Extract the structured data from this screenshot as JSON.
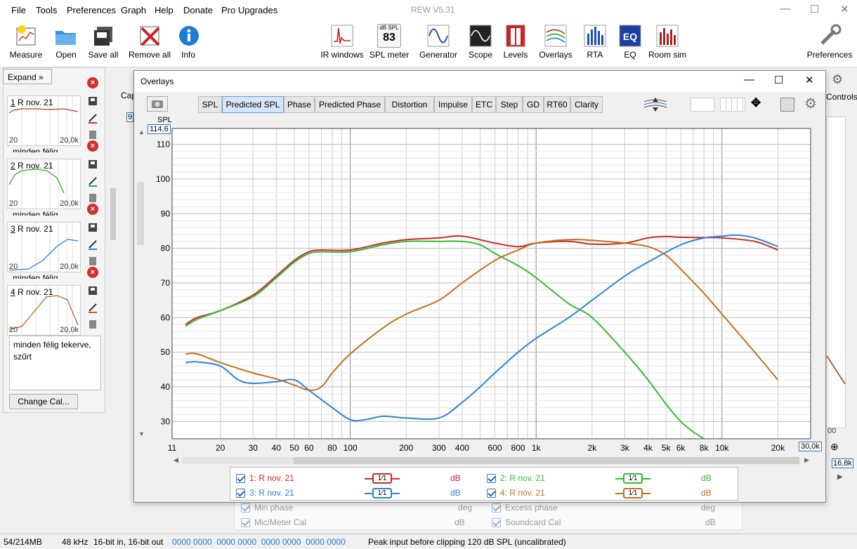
{
  "menu": [
    "File",
    "Tools",
    "Preferences",
    "Graph",
    "Help",
    "Donate",
    "Pro Upgrades"
  ],
  "app_title": "REW V5.31",
  "toolbar_left": [
    "Measure",
    "Open",
    "Save all",
    "Remove all",
    "Info"
  ],
  "toolbar_center": [
    "IR windows",
    "SPL meter",
    "Generator",
    "Scope",
    "Levels",
    "Overlays",
    "RTA",
    "EQ",
    "Room sim"
  ],
  "spl_meter": {
    "top": "dB SPL",
    "value": "83"
  },
  "toolbar_right": "Preferences",
  "left": {
    "expand": "Expand",
    "measurements": [
      {
        "num": "1",
        "name": "R nov. 21",
        "x_start": "20",
        "x_end": "20,0k",
        "color": "#c0392b",
        "subtitle": "minden félig"
      },
      {
        "num": "2",
        "name": "R nov. 21",
        "x_start": "20",
        "x_end": "20,0k",
        "color": "#2eaa2e",
        "subtitle": "minden félig"
      },
      {
        "num": "3",
        "name": "R nov. 21",
        "x_start": "20",
        "x_end": "20,0k",
        "color": "#2b7fd4",
        "subtitle": "minden félig"
      },
      {
        "num": "4",
        "name": "R nov. 21",
        "x_start": "20",
        "x_end": "20,0k",
        "color": "#b8661b",
        "subtitle": ""
      }
    ],
    "notes": "minden félig tekerve, szűrt",
    "change_cal": "Change Cal..."
  },
  "behind": {
    "cap": "Cap",
    "controls": "Controls",
    "nine": "9",
    "zero": "00",
    "k16": "16,8k"
  },
  "overlays": {
    "title": "Overlays",
    "tabs": [
      "SPL",
      "Predicted SPL",
      "Phase",
      "Predicted Phase",
      "Distortion",
      "Impulse",
      "ETC",
      "Step",
      "GD",
      "RT60",
      "Clarity"
    ],
    "active_tab": "Predicted SPL",
    "ylabel": "SPL",
    "ymax_box": "114,6",
    "xmax_box": "30,0k"
  },
  "chart_data": {
    "type": "line",
    "xscale": "log",
    "xlim": [
      11,
      30000
    ],
    "ylim": [
      25,
      114.6
    ],
    "yticks": [
      30,
      40,
      50,
      60,
      70,
      80,
      90,
      100,
      110
    ],
    "xticks": [
      {
        "v": 11,
        "l": "11"
      },
      {
        "v": 20,
        "l": "20"
      },
      {
        "v": 30,
        "l": "30"
      },
      {
        "v": 40,
        "l": "40"
      },
      {
        "v": 50,
        "l": "50"
      },
      {
        "v": 60,
        "l": "60"
      },
      {
        "v": 80,
        "l": "80"
      },
      {
        "v": 100,
        "l": "100"
      },
      {
        "v": 200,
        "l": "200"
      },
      {
        "v": 300,
        "l": "300"
      },
      {
        "v": 400,
        "l": "400"
      },
      {
        "v": 600,
        "l": "600"
      },
      {
        "v": 800,
        "l": "800"
      },
      {
        "v": 1000,
        "l": "1k"
      },
      {
        "v": 2000,
        "l": "2k"
      },
      {
        "v": 3000,
        "l": "3k"
      },
      {
        "v": 4000,
        "l": "4k"
      },
      {
        "v": 5000,
        "l": "5k"
      },
      {
        "v": 6000,
        "l": "6k"
      },
      {
        "v": 8000,
        "l": "8k"
      },
      {
        "v": 10000,
        "l": "10k"
      },
      {
        "v": 20000,
        "l": "20k"
      }
    ],
    "grid": true,
    "series": [
      {
        "name": "1: R nov. 21",
        "color": "#d02828",
        "x": [
          13,
          15,
          20,
          30,
          40,
          50,
          60,
          70,
          100,
          150,
          200,
          300,
          400,
          600,
          800,
          1000,
          1500,
          2000,
          3000,
          4000,
          5000,
          6000,
          8000,
          10000,
          15000,
          20000
        ],
        "y": [
          58,
          60,
          62,
          66.5,
          72,
          76.5,
          79,
          79.5,
          79.5,
          81.5,
          82.5,
          83,
          83.5,
          81.5,
          80.5,
          81.5,
          82,
          81.2,
          81.5,
          83,
          83.4,
          83.2,
          83.1,
          83,
          82,
          79.5
        ]
      },
      {
        "name": "2: R nov. 21",
        "color": "#33bb33",
        "x": [
          13,
          15,
          20,
          30,
          40,
          50,
          60,
          70,
          100,
          150,
          200,
          300,
          400,
          500,
          600,
          800,
          1000,
          1500,
          2000,
          3000,
          4000,
          5000,
          6000,
          7000,
          8000
        ],
        "y": [
          57.5,
          59.5,
          62,
          66,
          71.5,
          76,
          78.5,
          79,
          79,
          81,
          82,
          82,
          82,
          81,
          78.5,
          75,
          71.5,
          64,
          60,
          50,
          42,
          35,
          30,
          27,
          25
        ]
      },
      {
        "name": "3: R nov. 21",
        "color": "#2b84d4",
        "x": [
          13,
          15,
          20,
          25,
          30,
          40,
          50,
          60,
          80,
          100,
          120,
          150,
          200,
          300,
          400,
          500,
          600,
          800,
          1000,
          1500,
          2000,
          3000,
          4000,
          6000,
          8000,
          10000,
          12000,
          15000,
          20000
        ],
        "y": [
          47,
          47.2,
          46,
          42,
          41,
          41.5,
          42,
          39,
          34,
          30.5,
          30.5,
          31.5,
          31,
          31,
          35.5,
          40,
          44,
          50,
          54,
          60,
          65,
          72,
          76,
          81,
          83,
          83.5,
          83.8,
          83,
          80.5
        ]
      },
      {
        "name": "4: R nov. 21",
        "color": "#c2701e",
        "x": [
          13,
          15,
          20,
          30,
          40,
          50,
          60,
          70,
          80,
          100,
          150,
          200,
          300,
          400,
          600,
          800,
          1000,
          1500,
          2000,
          3000,
          4000,
          5000,
          6000,
          8000,
          10000,
          15000,
          20000
        ],
        "y": [
          49.5,
          49.5,
          47,
          44,
          42.3,
          40.5,
          39,
          40,
          44,
          49.5,
          57,
          61,
          65,
          70,
          76.5,
          79.5,
          81.5,
          82.5,
          82.3,
          81.5,
          80.5,
          78,
          74,
          67,
          61,
          50,
          42
        ]
      }
    ]
  },
  "legend": [
    {
      "label": "1: R nov. 21",
      "unit": "dB",
      "color": "#d02828",
      "smooth": "1⁄1"
    },
    {
      "label": "2: R nov. 21",
      "unit": "dB",
      "color": "#33bb33",
      "smooth": "1⁄1"
    },
    {
      "label": "3: R nov. 21",
      "unit": "dB",
      "color": "#2b84d4",
      "smooth": "1⁄1"
    },
    {
      "label": "4: R nov. 21",
      "unit": "dB",
      "color": "#c2701e",
      "smooth": "1⁄1"
    }
  ],
  "below_legend": [
    {
      "label": "Min phase",
      "unit": "deg"
    },
    {
      "label": "Excess phase",
      "unit": "deg"
    },
    {
      "label": "Mic/Meter Cal",
      "unit": "dB"
    },
    {
      "label": "Soundcard Cal",
      "unit": "dB"
    }
  ],
  "status": {
    "memory": "54/214MB",
    "rate": "48 kHz",
    "bits": "16-bit in, 16-bit out",
    "bits_display": "0000 0000  0000 0000  0000 0000  0000 0000",
    "message": "Peak input before clipping 120 dB SPL (uncalibrated)"
  }
}
